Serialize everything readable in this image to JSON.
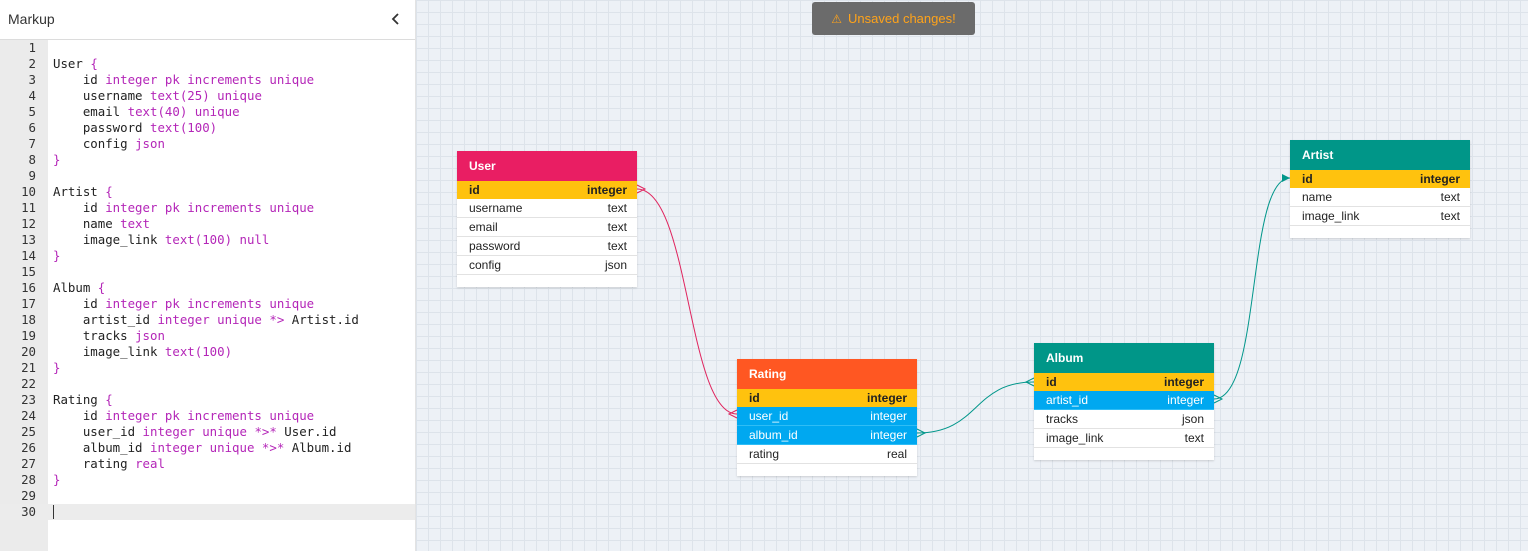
{
  "panel": {
    "title": "Markup",
    "collapse_icon": "chevron-left-icon"
  },
  "editor": {
    "lines": [
      "",
      "User {",
      "    id integer pk increments unique",
      "    username text(25) unique",
      "    email text(40) unique",
      "    password text(100)",
      "    config json",
      "}",
      "",
      "Artist {",
      "    id integer pk increments unique",
      "    name text",
      "    image_link text(100) null",
      "}",
      "",
      "Album {",
      "    id integer pk increments unique",
      "    artist_id integer unique *> Artist.id",
      "    tracks json",
      "    image_link text(100)",
      "}",
      "",
      "Rating {",
      "    id integer pk increments unique",
      "    user_id integer unique *>* User.id",
      "    album_id integer unique *>* Album.id",
      "    rating real",
      "}",
      "",
      ""
    ],
    "active_line": 30
  },
  "status": {
    "unsaved_label": "Unsaved changes!",
    "icon": "warning-icon"
  },
  "colors": {
    "user": "#e91e63",
    "artist": "#009688",
    "album": "#009688",
    "rating": "#ff5722",
    "pk": "#ffc20e",
    "fk": "#00a8f0",
    "link_user": "#e0245e",
    "link_album": "#00968a"
  },
  "tables": [
    {
      "key": "user",
      "name": "User",
      "columns": [
        {
          "name": "id",
          "type": "integer",
          "kind": "pk"
        },
        {
          "name": "username",
          "type": "text",
          "kind": ""
        },
        {
          "name": "email",
          "type": "text",
          "kind": ""
        },
        {
          "name": "password",
          "type": "text",
          "kind": ""
        },
        {
          "name": "config",
          "type": "json",
          "kind": ""
        }
      ]
    },
    {
      "key": "artist",
      "name": "Artist",
      "columns": [
        {
          "name": "id",
          "type": "integer",
          "kind": "pk"
        },
        {
          "name": "name",
          "type": "text",
          "kind": ""
        },
        {
          "name": "image_link",
          "type": "text",
          "kind": ""
        }
      ]
    },
    {
      "key": "rating",
      "name": "Rating",
      "columns": [
        {
          "name": "id",
          "type": "integer",
          "kind": "pk"
        },
        {
          "name": "user_id",
          "type": "integer",
          "kind": "fk"
        },
        {
          "name": "album_id",
          "type": "integer",
          "kind": "fk"
        },
        {
          "name": "rating",
          "type": "real",
          "kind": ""
        }
      ]
    },
    {
      "key": "album",
      "name": "Album",
      "columns": [
        {
          "name": "id",
          "type": "integer",
          "kind": "pk"
        },
        {
          "name": "artist_id",
          "type": "integer",
          "kind": "fk"
        },
        {
          "name": "tracks",
          "type": "json",
          "kind": ""
        },
        {
          "name": "image_link",
          "type": "text",
          "kind": ""
        }
      ]
    }
  ]
}
